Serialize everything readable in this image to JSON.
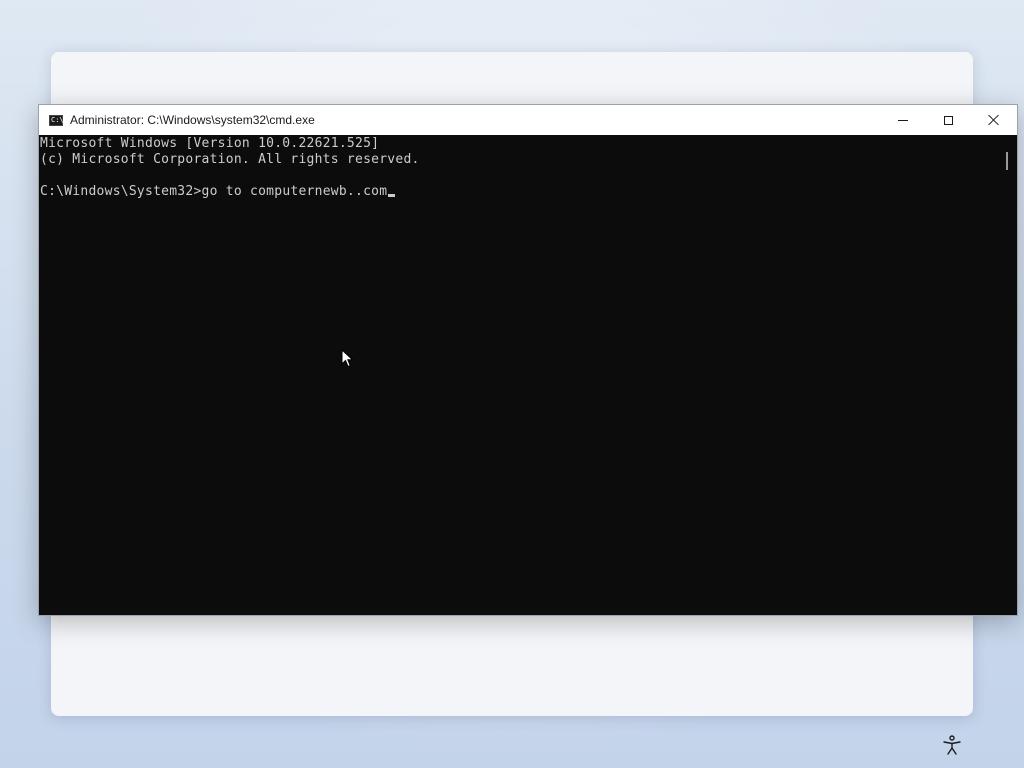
{
  "window": {
    "title": "Administrator: C:\\Windows\\system32\\cmd.exe",
    "icon": "cmd-icon",
    "icon_glyph": "C:\\",
    "controls": {
      "minimize": "minimize-icon",
      "maximize": "maximize-icon",
      "close": "close-icon"
    }
  },
  "console": {
    "lines": [
      "Microsoft Windows [Version 10.0.22621.525]",
      "(c) Microsoft Corporation. All rights reserved.",
      ""
    ],
    "prompt": "C:\\Windows\\System32>",
    "input": "go to computernewb..com"
  },
  "taskbar": {
    "accessibility_icon": "accessibility-icon"
  },
  "colors": {
    "console_bg": "#0c0c0c",
    "console_text": "#cccccc",
    "title_bar_bg": "#ffffff",
    "panel_bg": "#f3f5f9"
  }
}
